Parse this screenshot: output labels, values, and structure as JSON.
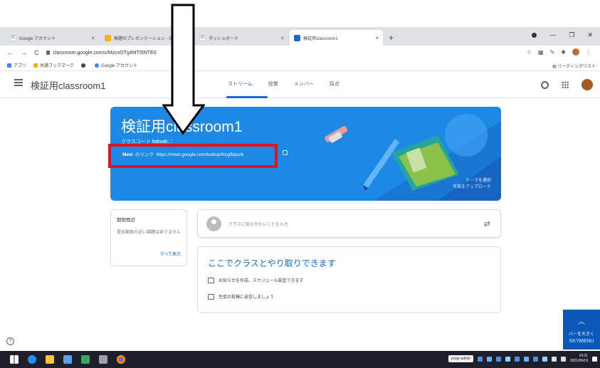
{
  "browser": {
    "tabs": [
      {
        "label": "Google アカウント",
        "favicon_color": "#4285f4",
        "favicon_letter": "G"
      },
      {
        "label": "無題のプレゼンテーション - Goo",
        "favicon_color": "#f4b400",
        "favicon_letter": ""
      },
      {
        "label": "ダッシュボード",
        "favicon_color": "#4285f4",
        "favicon_letter": "G"
      },
      {
        "label": "検証用classroom1",
        "favicon_color": "#1967d2",
        "favicon_letter": "",
        "active": true
      }
    ],
    "new_tab": "+",
    "tab_close": "×",
    "url": "classroom.google.com/c/MzcxOTg4MTI5NTE0",
    "back": "←",
    "forward": "→",
    "reload": "C",
    "bookmarks": [
      {
        "label": "アプリ",
        "color": "#4285f4"
      },
      {
        "label": "共通ブックマーク",
        "color": "#f4b400"
      },
      {
        "label": "",
        "color": "#444444"
      },
      {
        "label": "Google アカウント",
        "color": "#4285f4"
      }
    ],
    "reading_list": "リーディングリスト"
  },
  "classroom": {
    "class_name": "検証用classroom1",
    "tabs": [
      "ストリーム",
      "授業",
      "メンバー",
      "採点"
    ],
    "active_tab": "ストリーム",
    "banner": {
      "title": "検証用classroom1",
      "class_code_label": "クラスコード",
      "class_code": "hdnoh",
      "meet_label": "Meet",
      "meet_link_label": "のリンク",
      "meet_url": "https://meet.google.com/lookup/forgfbpuzb",
      "theme_select": "テーマを選択",
      "upload_photo": "写真をアップロード",
      "color": "#1e88e5"
    },
    "upcoming": {
      "heading": "期限間近",
      "body": "提出期限の近い課題はありません",
      "view_all": "すべて表示"
    },
    "post": {
      "placeholder": "クラスに知らせたいことを入力",
      "reorder_icon": "⇄"
    },
    "info": {
      "heading": "ここでクラスとやり取りできます",
      "items": [
        "お知らせを作成、スケジュール設定できます",
        "生徒の投稿に返信しましょう"
      ]
    }
  },
  "skymenu": {
    "label": "バーを大きく",
    "brand": "SKYMENU"
  },
  "taskbar": {
    "user": "progr-admin",
    "time": "13:31",
    "date": "2021/06/19"
  },
  "annotation": {
    "highlight_color": "#e0151b"
  }
}
